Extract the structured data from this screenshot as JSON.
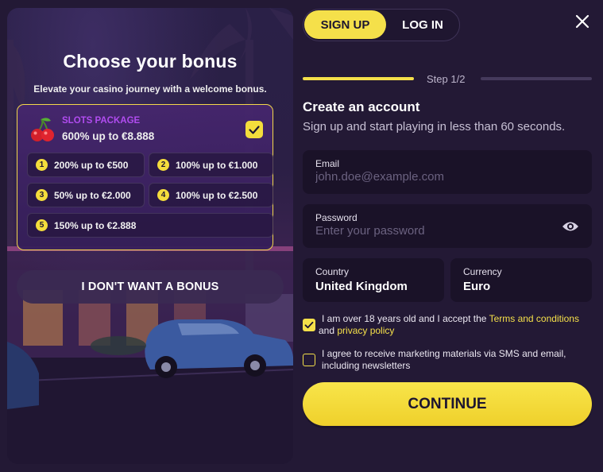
{
  "colors": {
    "accent": "#f5e04a",
    "background": "#231935",
    "package_label": "#b14cf0"
  },
  "bonus": {
    "title": "Choose your bonus",
    "subtitle": "Elevate your casino journey with a welcome bonus.",
    "package": {
      "name": "SLOTS PACKAGE",
      "amount": "600% up to €8.888",
      "icon": "cherry-icon",
      "selected": true
    },
    "tiers": [
      {
        "num": "1",
        "label": "200% up to €500"
      },
      {
        "num": "2",
        "label": "100% up to €1.000"
      },
      {
        "num": "3",
        "label": "50% up to €2.000"
      },
      {
        "num": "4",
        "label": "100% up to €2.500"
      },
      {
        "num": "5",
        "label": "150% up to €2.888"
      }
    ],
    "no_bonus_label": "I DON'T WANT A BONUS"
  },
  "auth": {
    "tabs": {
      "signup": "SIGN UP",
      "login": "LOG IN",
      "active": "signup"
    },
    "close_icon": "close-icon",
    "step_label": "Step 1/2",
    "title": "Create an account",
    "subtitle": "Sign up and start playing in less than 60 seconds.",
    "email": {
      "label": "Email",
      "placeholder": "john.doe@example.com",
      "value": ""
    },
    "password": {
      "label": "Password",
      "placeholder": "Enter your password",
      "value": "",
      "icon": "eye-icon"
    },
    "country": {
      "label": "Country",
      "value": "United Kingdom"
    },
    "currency": {
      "label": "Currency",
      "value": "Euro"
    },
    "consent_age": {
      "checked": true,
      "text_before": "I am over 18 years old and I accept the ",
      "terms_link": "Terms and conditions",
      "text_and": " and ",
      "privacy_link": "privacy policy"
    },
    "consent_marketing": {
      "checked": false,
      "text": "I agree to receive marketing materials via SMS and email, including newsletters"
    },
    "continue_label": "CONTINUE"
  }
}
